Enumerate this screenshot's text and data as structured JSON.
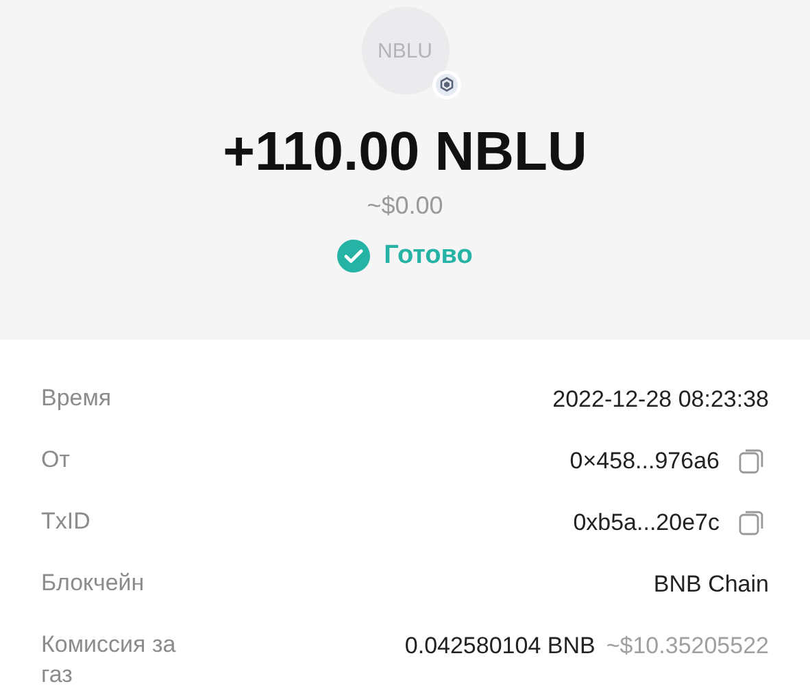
{
  "token": {
    "symbol": "NBLU"
  },
  "amount": "+110.00 NBLU",
  "fiat": "~$0.00",
  "status": {
    "label": "Готово",
    "kind": "done"
  },
  "details": [
    {
      "label": "Время",
      "value": "2022-12-28 08:23:38",
      "copyable": false
    },
    {
      "label": "От",
      "value": "0×458...976a6",
      "copyable": true
    },
    {
      "label": "TxID",
      "value": "0xb5a...20e7c",
      "copyable": true
    },
    {
      "label": "Блокчейн",
      "value": "BNB Chain",
      "copyable": false
    },
    {
      "label": "Комиссия за газ",
      "value": "0.042580104 BNB",
      "fiat": "~$10.35205522",
      "copyable": false
    }
  ]
}
